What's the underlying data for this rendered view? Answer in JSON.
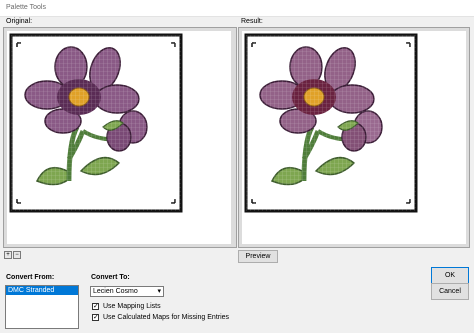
{
  "window": {
    "title": "Palette Tools"
  },
  "original": {
    "label": "Original:"
  },
  "result": {
    "label": "Result:"
  },
  "preview_button": "Preview",
  "ok_button": "OK",
  "cancel_button": "Cancel",
  "zoom": {
    "zoom_in_icon": "zoom-in-icon",
    "zoom_out_icon": "zoom-out-icon"
  },
  "convert_from": {
    "label": "Convert From:",
    "items": [
      "DMC Stranded Cotton"
    ],
    "selected": "DMC Stranded Cotton"
  },
  "convert_to": {
    "label": "Convert To:",
    "selected": "Lecien Cosmo"
  },
  "options": {
    "use_mapping_lists": {
      "label": "Use Mapping Lists",
      "checked": true
    },
    "use_calculated_maps": {
      "label": "Use Calculated Maps for Missing Entries",
      "checked": true
    }
  },
  "colors": {
    "petal": "#8a5a86",
    "petal_dark": "#5a2c55",
    "center": "#e0a128",
    "leaf": "#7ea650",
    "stem": "#4f7d3a",
    "frame": "#111111",
    "selection": "#0078d7"
  }
}
